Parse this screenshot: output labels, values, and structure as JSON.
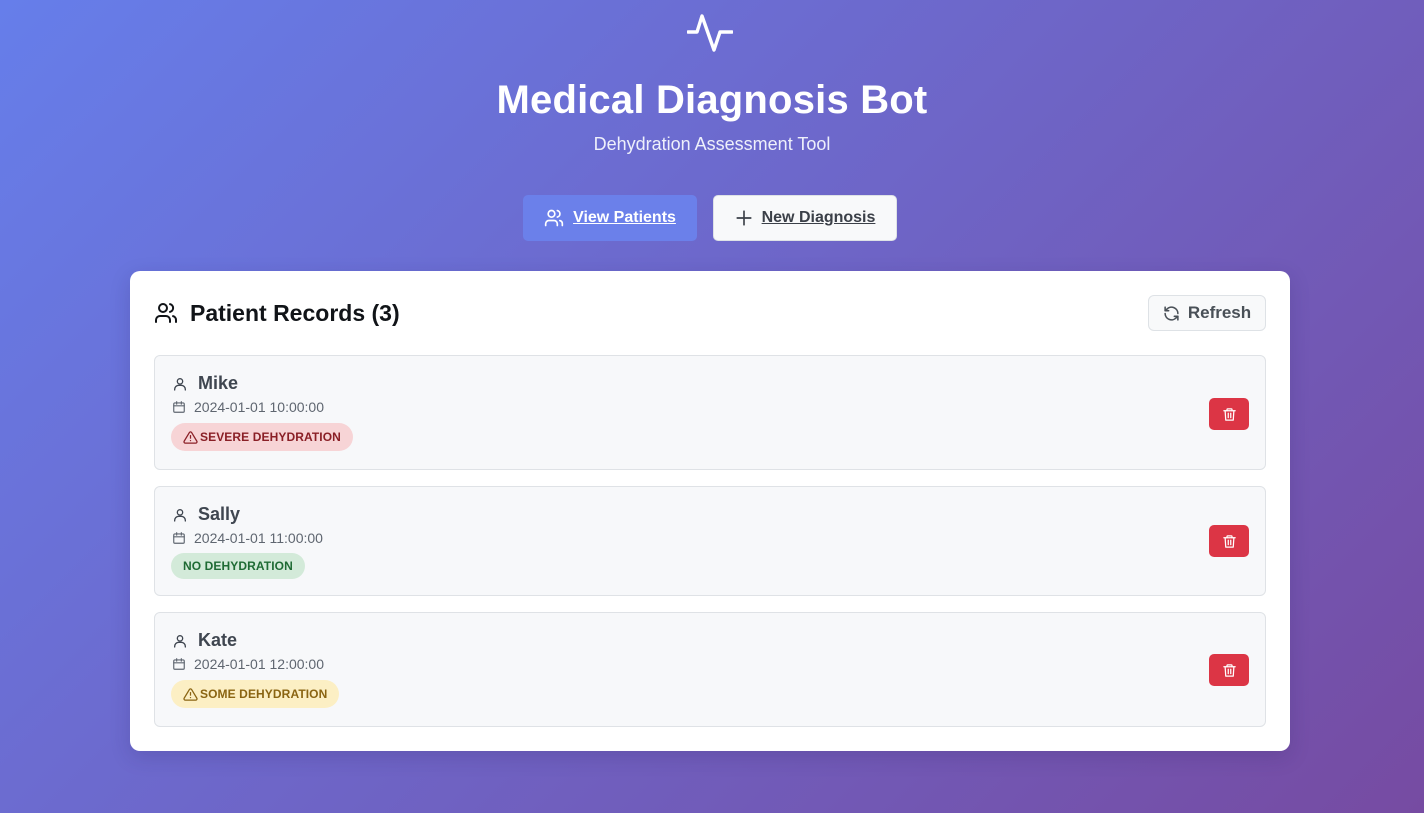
{
  "header": {
    "logo_icon": "activity-pulse-icon",
    "title": "Medical Diagnosis Bot",
    "subtitle": "Dehydration Assessment Tool"
  },
  "nav": {
    "view_patients_label": "View Patients",
    "view_patients_icon": "users-icon",
    "new_diagnosis_label": "New Diagnosis",
    "new_diagnosis_icon": "plus-icon"
  },
  "records_panel": {
    "title": "Patient Records (3)",
    "title_icon": "users-icon",
    "refresh_label": "Refresh",
    "refresh_icon": "refresh-icon",
    "patients": [
      {
        "name": "Mike",
        "date": "2024-01-01 10:00:00",
        "status": "SEVERE DEHYDRATION",
        "status_level": "severe",
        "status_icon": "alert-triangle-icon"
      },
      {
        "name": "Sally",
        "date": "2024-01-01 11:00:00",
        "status": "NO DEHYDRATION",
        "status_level": "none",
        "status_icon": ""
      },
      {
        "name": "Kate",
        "date": "2024-01-01 12:00:00",
        "status": "SOME DEHYDRATION",
        "status_level": "some",
        "status_icon": "alert-triangle-icon"
      }
    ]
  },
  "colors": {
    "gradient_start": "#667eea",
    "gradient_end": "#764ba2",
    "primary_button": "#6b80ea",
    "delete_button": "#dc3545",
    "severe_badge": "#f7d4d6",
    "none_badge": "#d3ead9",
    "some_badge": "#fcefc4"
  }
}
